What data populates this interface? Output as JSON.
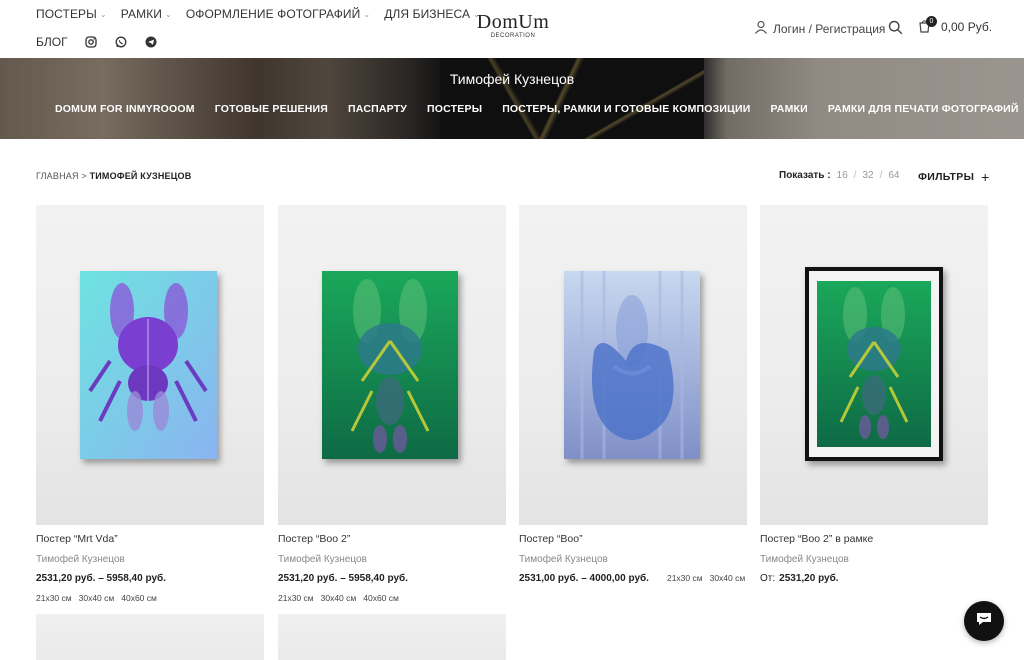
{
  "nav": {
    "top": [
      "ПОСТЕРЫ",
      "РАМКИ",
      "ОФОРМЛЕНИЕ ФОТОГРАФИЙ",
      "ДЛЯ БИЗНЕСА"
    ],
    "blog": "БЛОГ",
    "social_icons": [
      "instagram-icon",
      "whatsapp-icon",
      "telegram-icon"
    ]
  },
  "logo": {
    "main": "DomUm",
    "sub": "DECORATION"
  },
  "account": {
    "label": "Логин / Регистрация"
  },
  "cart": {
    "count": "0",
    "total": "0,00 Руб."
  },
  "banner": {
    "title": "Тимофей Кузнецов",
    "categories": [
      "DOMUM FOR INMYROOOM",
      "ГОТОВЫЕ РЕШЕНИЯ",
      "ПАСПАРТУ",
      "ПОСТЕРЫ",
      "ПОСТЕРЫ, РАМКИ И ГОТОВЫЕ КОМПОЗИЦИИ",
      "РАМКИ",
      "РАМКИ ДЛЯ ПЕЧАТИ ФОТОГРАФИЙ"
    ]
  },
  "breadcrumb": {
    "home": "ГЛАВНАЯ",
    "sep": ">",
    "current": "ТИМОФЕЙ КУЗНЕЦОВ"
  },
  "toolbar": {
    "show_label": "Показать :",
    "options": [
      "16",
      "32",
      "64"
    ],
    "separator": "/",
    "filters_label": "ФИЛЬТРЫ",
    "filters_icon": "+"
  },
  "products": [
    {
      "name": "Постер “Mrt Vda”",
      "author": "Тимофей Кузнецов",
      "price": "2531,20 руб. – 5958,40 руб.",
      "sizes": [
        "21x30 см",
        "30x40 см",
        "40x60 см"
      ]
    },
    {
      "name": "Постер “Boo 2”",
      "author": "Тимофей Кузнецов",
      "price": "2531,20 руб. – 5958,40 руб.",
      "sizes": [
        "21x30 см",
        "30x40 см",
        "40x60 см"
      ]
    },
    {
      "name": "Постер “Boo”",
      "author": "Тимофей Кузнецов",
      "price": "2531,00 руб. – 4000,00 руб.",
      "sizes": [
        "21x30 см",
        "30x40 см"
      ]
    },
    {
      "name": "Постер “Boo 2” в рамке",
      "author": "Тимофей Кузнецов",
      "price_prefix": "От:",
      "price": "2531,20 руб.",
      "sizes": []
    }
  ],
  "colors": {
    "accent": "#222222",
    "muted": "#888888"
  }
}
